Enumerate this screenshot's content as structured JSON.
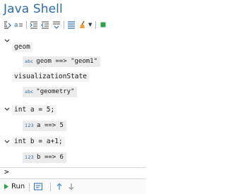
{
  "app": {
    "title": "Java Shell"
  },
  "toolbar": {
    "icons": [
      "format-icon",
      "assign-icon",
      "indent-icon",
      "outdent-icon",
      "collapse-icon",
      "list-icon",
      "clear-icon",
      "dropdown-icon",
      "stop-icon"
    ],
    "stop_color": "#2ca24a"
  },
  "history": [
    {
      "code": "geom",
      "result_type": "abc",
      "result": "geom ==> \"geom1\""
    },
    {
      "code": "visualizationState",
      "result_type": "abc",
      "result": "\"geometry\""
    },
    {
      "code": "int a = 5;",
      "result_type": "123",
      "result": "a ==> 5"
    },
    {
      "code": "int b = a+1;",
      "result_type": "123",
      "result": "b ==> 6"
    }
  ],
  "prompt": {
    "symbol": ">"
  },
  "bottom": {
    "run_label": "Run"
  },
  "colors": {
    "accent": "#2b6cb0",
    "run_green": "#2ca24a",
    "nav_blue": "#4a90d9"
  }
}
